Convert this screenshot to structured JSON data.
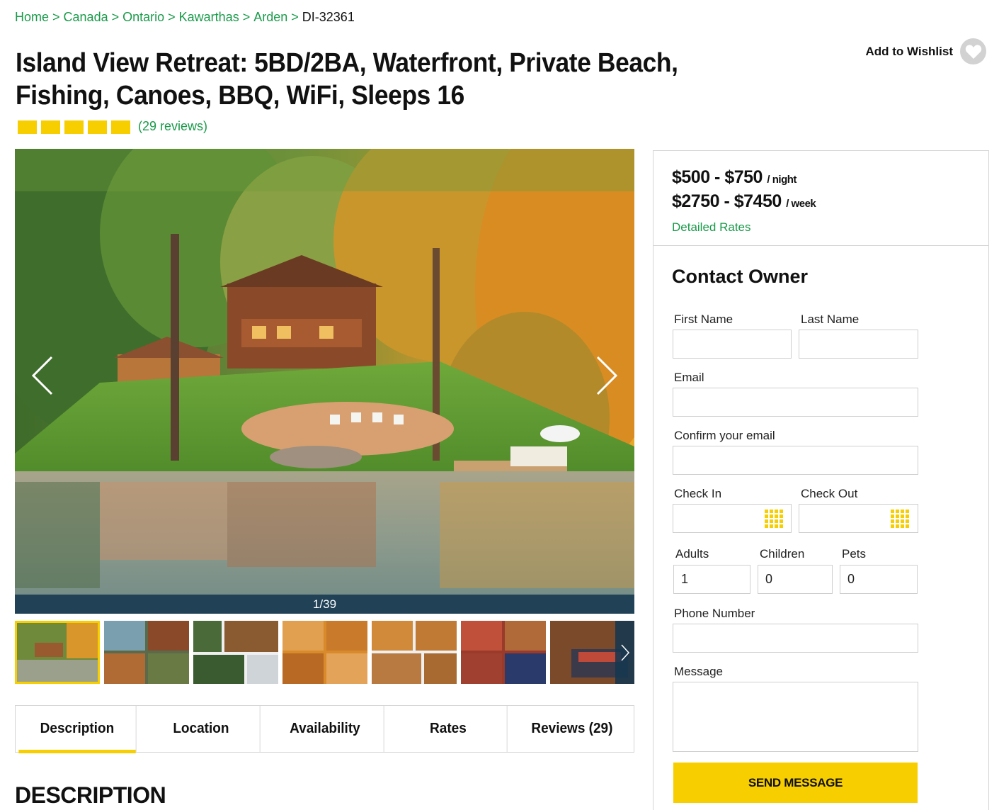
{
  "breadcrumb": {
    "items": [
      "Home",
      "Canada",
      "Ontario",
      "Kawarthas",
      "Arden"
    ],
    "current": "DI-32361"
  },
  "listing": {
    "title": "Island View Retreat: 5BD/2BA, Waterfront, Private Beach, Fishing, Canoes, BBQ, WiFi, Sleeps 16",
    "rating_stars": 5,
    "reviews_link": "(29 reviews)"
  },
  "wishlist": {
    "label": "Add to Wishlist"
  },
  "gallery": {
    "counter": "1/39",
    "thumbnail_count": 7
  },
  "tabs": [
    {
      "label": "Description",
      "active": true
    },
    {
      "label": "Location",
      "active": false
    },
    {
      "label": "Availability",
      "active": false
    },
    {
      "label": "Rates",
      "active": false
    },
    {
      "label": "Reviews (29)",
      "active": false
    }
  ],
  "section_heading": "DESCRIPTION",
  "pricing": {
    "nightly": "$500 - $750",
    "nightly_unit": "/ night",
    "weekly": "$2750 - $7450",
    "weekly_unit": "/ week",
    "detailed_rates_link": "Detailed Rates"
  },
  "contact_form": {
    "title": "Contact Owner",
    "first_name_label": "First Name",
    "first_name_value": "",
    "last_name_label": "Last Name",
    "last_name_value": "",
    "email_label": "Email",
    "email_value": "",
    "confirm_email_label": "Confirm your email",
    "confirm_email_value": "",
    "check_in_label": "Check In",
    "check_in_value": "",
    "check_out_label": "Check Out",
    "check_out_value": "",
    "adults_label": "Adults",
    "adults_value": "1",
    "children_label": "Children",
    "children_value": "0",
    "pets_label": "Pets",
    "pets_value": "0",
    "phone_label": "Phone Number",
    "phone_value": "",
    "message_label": "Message",
    "message_value": "",
    "submit_label": "SEND MESSAGE"
  },
  "colors": {
    "accent_yellow": "#f7ce00",
    "link_green": "#1a9a4a",
    "gallery_bar": "#143750"
  }
}
